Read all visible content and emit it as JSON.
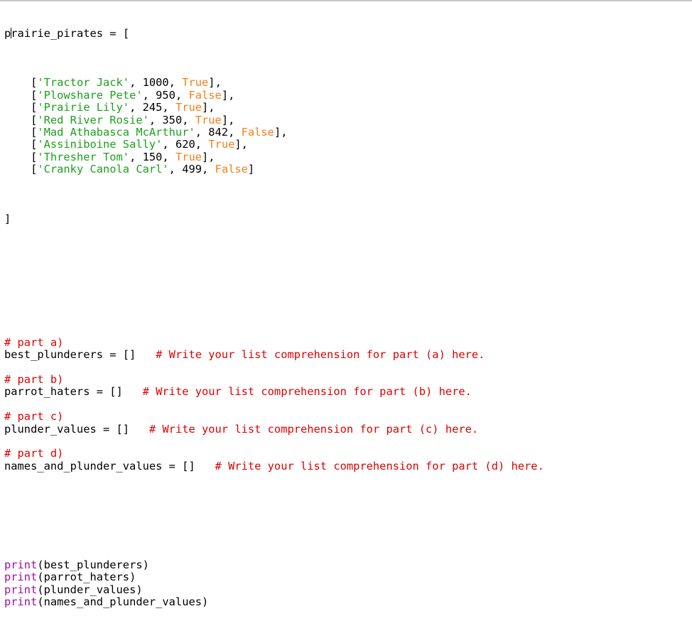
{
  "editor": {
    "var_name": "prairie_pirates",
    "assign_open": " = [",
    "rows": [
      {
        "name": "'Tractor Jack'",
        "value": "1000",
        "flag": "True"
      },
      {
        "name": "'Plowshare Pete'",
        "value": "950",
        "flag": "False"
      },
      {
        "name": "'Prairie Lily'",
        "value": "245",
        "flag": "True"
      },
      {
        "name": "'Red River Rosie'",
        "value": "350",
        "flag": "True"
      },
      {
        "name": "'Mad Athabasca McArthur'",
        "value": "842",
        "flag": "False"
      },
      {
        "name": "'Assiniboine Sally'",
        "value": "620",
        "flag": "True"
      },
      {
        "name": "'Thresher Tom'",
        "value": "150",
        "flag": "True"
      },
      {
        "name": "'Cranky Canola Carl'",
        "value": "499",
        "flag": "False"
      }
    ],
    "close_bracket": "]",
    "parts": [
      {
        "header": "# part a)",
        "code": "best_plunderers = []",
        "gap": "   ",
        "comment": "# Write your list comprehension for part (a) here."
      },
      {
        "header": "# part b)",
        "code": "parrot_haters = []",
        "gap": "   ",
        "comment": "# Write your list comprehension for part (b) here."
      },
      {
        "header": "# part c)",
        "code": "plunder_values = []",
        "gap": "   ",
        "comment": "# Write your list comprehension for part (c) here."
      },
      {
        "header": "# part d)",
        "code": "names_and_plunder_values = []",
        "gap": "   ",
        "comment": "# Write your list comprehension for part (d) here."
      }
    ],
    "print_fn": "print",
    "prints": [
      "(best_plunderers)",
      "(parrot_haters)",
      "(plunder_values)",
      "(names_and_plunder_values)"
    ]
  }
}
